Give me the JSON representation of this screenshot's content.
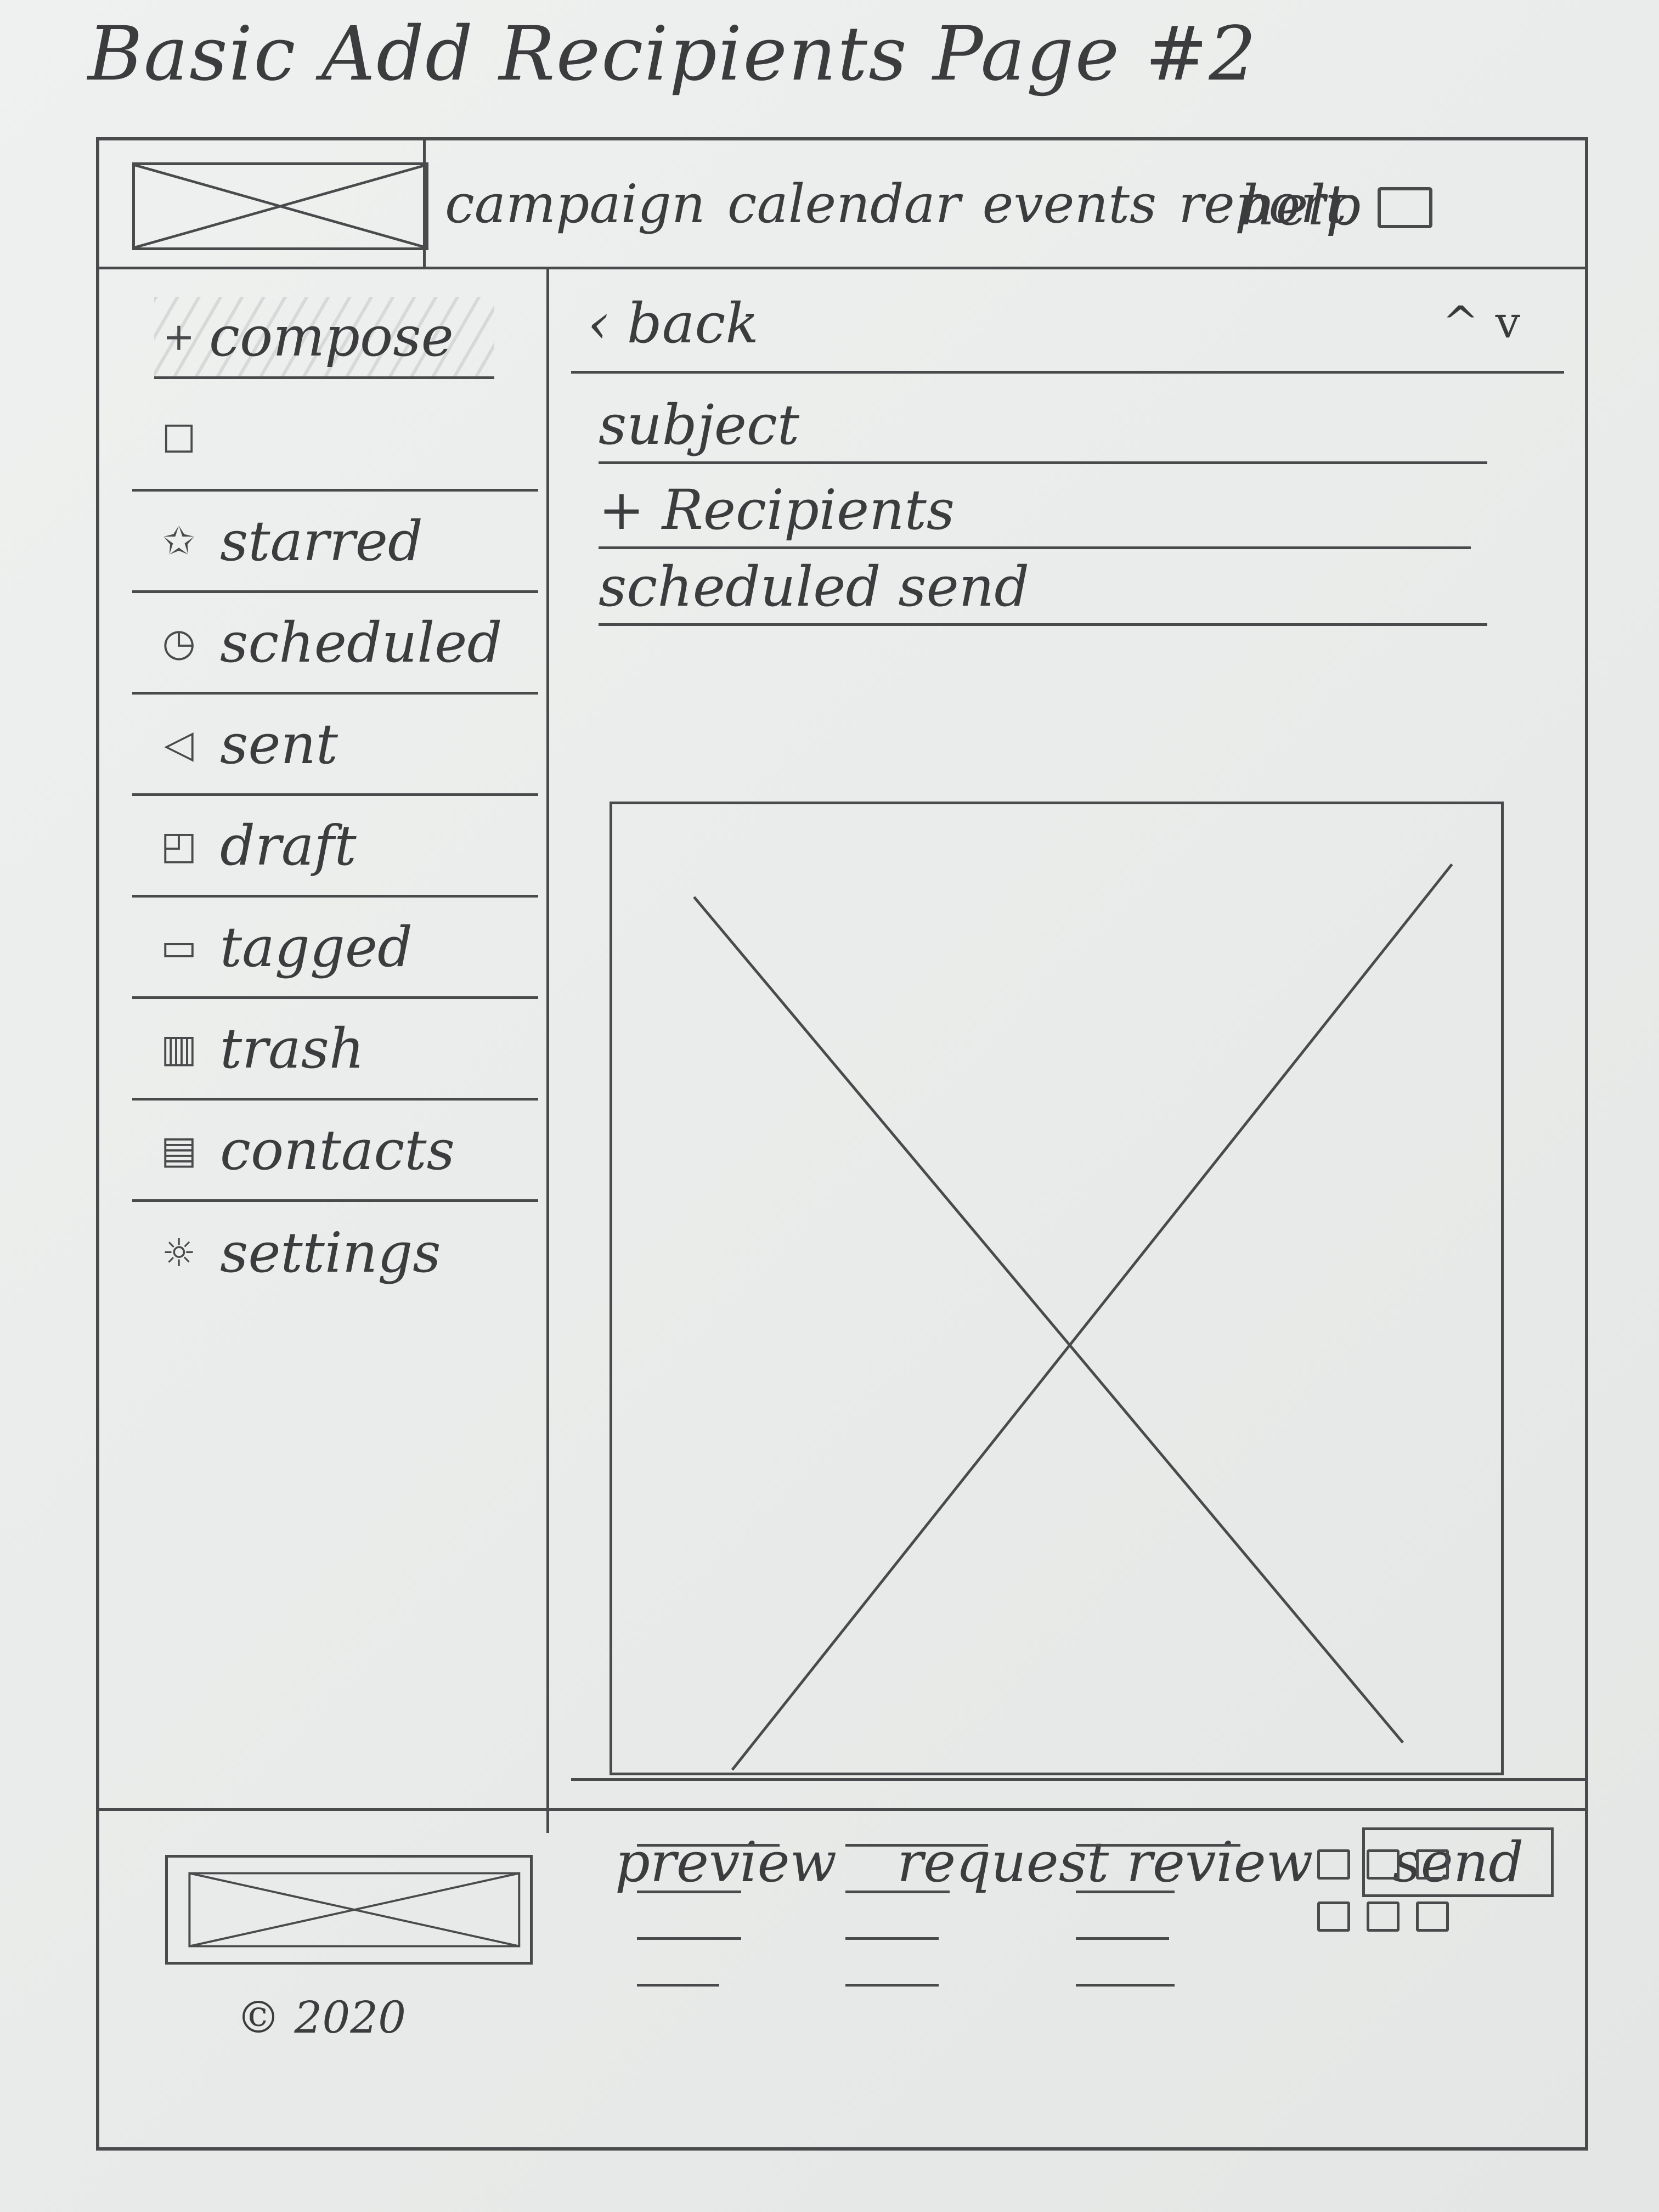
{
  "page_title": "Basic Add Recipients Page #2",
  "header": {
    "nav": [
      "campaign",
      "calendar",
      "events",
      "report"
    ],
    "help": "help",
    "user_icon": "user-icon"
  },
  "sidebar": {
    "compose": "compose",
    "items": [
      {
        "label": "",
        "icon": "inbox-icon"
      },
      {
        "label": "starred",
        "icon": "star-icon"
      },
      {
        "label": "scheduled",
        "icon": "clock-icon"
      },
      {
        "label": "sent",
        "icon": "send-icon"
      },
      {
        "label": "draft",
        "icon": "draft-icon"
      },
      {
        "label": "tagged",
        "icon": "tag-icon"
      },
      {
        "label": "trash",
        "icon": "trash-icon"
      },
      {
        "label": "contacts",
        "icon": "contacts-icon"
      },
      {
        "label": "settings",
        "icon": "gear-icon"
      }
    ]
  },
  "main": {
    "back": "back",
    "subject": "subject",
    "recipients": "Recipients",
    "schedule": "scheduled send",
    "actions": {
      "preview": "preview",
      "request_review": "request review",
      "send": "send"
    }
  },
  "footer": {
    "copyright": "© 2020"
  }
}
